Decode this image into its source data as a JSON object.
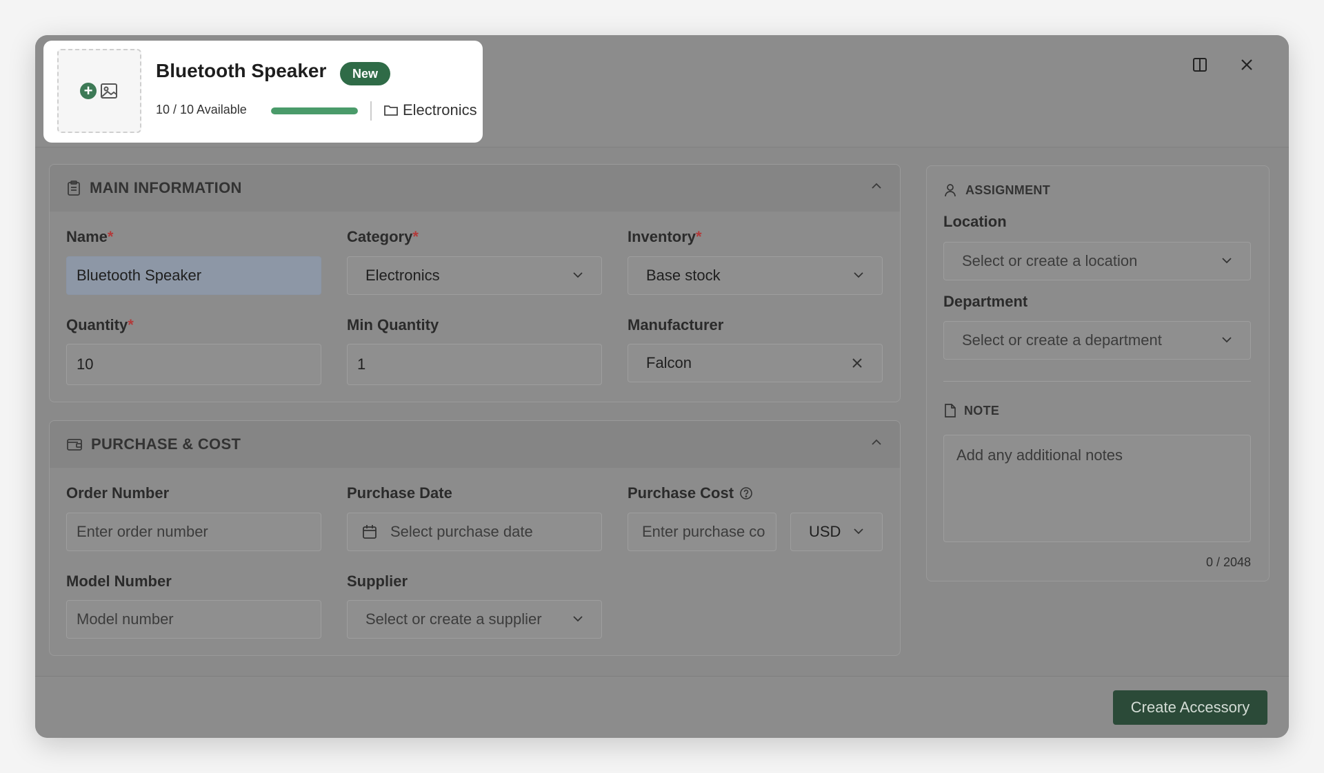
{
  "header": {
    "title": "Bluetooth Speaker",
    "badge": "New",
    "availability_text": "10 / 10 Available",
    "availability_fraction": 1.0,
    "category": "Electronics",
    "icons": [
      "add-image-icon",
      "split-panel-icon",
      "close-icon"
    ]
  },
  "main_info": {
    "section_title": "MAIN INFORMATION",
    "required_mark": "*",
    "name": {
      "label": "Name",
      "value": "Bluetooth Speaker"
    },
    "category": {
      "label": "Category",
      "value": "Electronics"
    },
    "inventory": {
      "label": "Inventory",
      "value": "Base stock"
    },
    "quantity": {
      "label": "Quantity",
      "value": "10"
    },
    "min_quantity": {
      "label": "Min Quantity",
      "value": "1"
    },
    "manufacturer": {
      "label": "Manufacturer",
      "value": "Falcon"
    }
  },
  "purchase": {
    "section_title": "PURCHASE & COST",
    "order_number": {
      "label": "Order Number",
      "placeholder": "Enter order number"
    },
    "purchase_date": {
      "label": "Purchase Date",
      "placeholder": "Select purchase date"
    },
    "purchase_cost": {
      "label": "Purchase Cost",
      "placeholder": "Enter purchase co"
    },
    "currency": {
      "value": "USD"
    },
    "model_number": {
      "label": "Model Number",
      "placeholder": "Model number"
    },
    "supplier": {
      "label": "Supplier",
      "placeholder": "Select or create a supplier"
    }
  },
  "assignment": {
    "section_title": "ASSIGNMENT",
    "location": {
      "label": "Location",
      "placeholder": "Select or create a location"
    },
    "department": {
      "label": "Department",
      "placeholder": "Select or create a department"
    }
  },
  "note": {
    "section_title": "NOTE",
    "placeholder": "Add any additional notes",
    "counter": "0 / 2048"
  },
  "footer": {
    "create_label": "Create Accessory"
  },
  "colors": {
    "accent": "#2f6b47",
    "progress": "#4a9b6a",
    "required": "#b33a3a",
    "primary_button": "#2b4a38"
  }
}
